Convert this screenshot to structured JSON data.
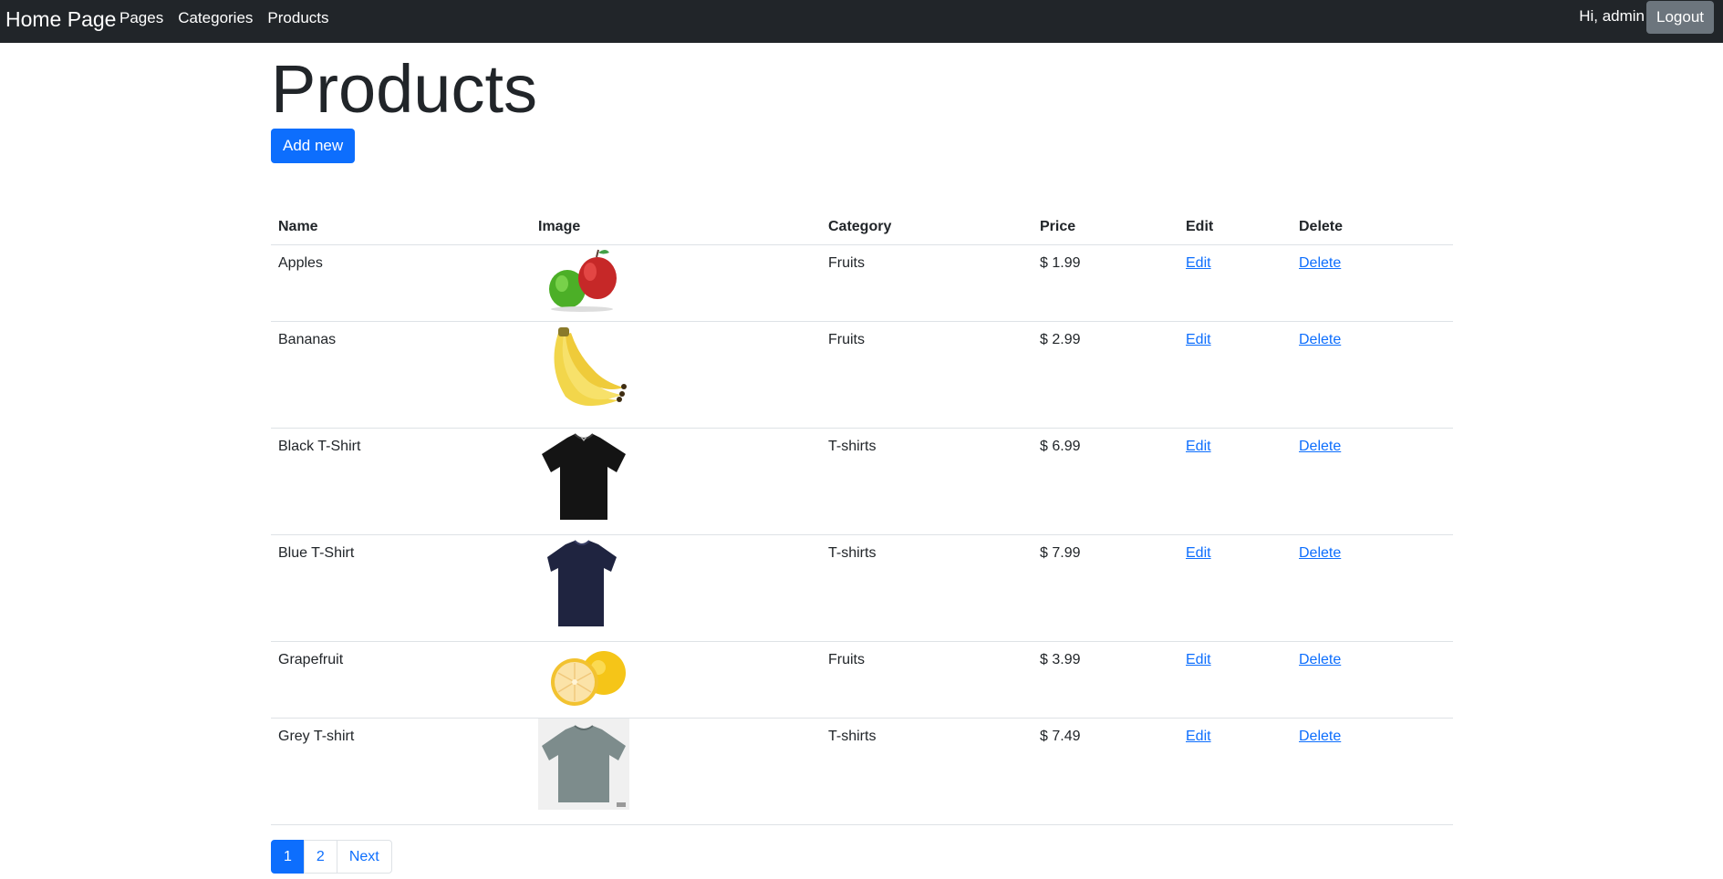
{
  "navbar": {
    "brand": "Home Page",
    "links": [
      "Pages",
      "Categories",
      "Products"
    ],
    "greeting": "Hi, admin",
    "logout_label": "Logout"
  },
  "page": {
    "title": "Products",
    "add_label": "Add new"
  },
  "table": {
    "headers": [
      "Name",
      "Image",
      "Category",
      "Price",
      "Edit",
      "Delete"
    ],
    "rows": [
      {
        "name": "Apples",
        "image": "apples",
        "category": "Fruits",
        "price": "$ 1.99",
        "edit": "Edit",
        "delete": "Delete"
      },
      {
        "name": "Bananas",
        "image": "bananas",
        "category": "Fruits",
        "price": "$ 2.99",
        "edit": "Edit",
        "delete": "Delete"
      },
      {
        "name": "Black T-Shirt",
        "image": "black-tshirt",
        "category": "T-shirts",
        "price": "$ 6.99",
        "edit": "Edit",
        "delete": "Delete"
      },
      {
        "name": "Blue T-Shirt",
        "image": "blue-tshirt",
        "category": "T-shirts",
        "price": "$ 7.99",
        "edit": "Edit",
        "delete": "Delete"
      },
      {
        "name": "Grapefruit",
        "image": "grapefruit",
        "category": "Fruits",
        "price": "$ 3.99",
        "edit": "Edit",
        "delete": "Delete"
      },
      {
        "name": "Grey T-shirt",
        "image": "grey-tshirt",
        "category": "T-shirts",
        "price": "$ 7.49",
        "edit": "Edit",
        "delete": "Delete"
      }
    ]
  },
  "pagination": {
    "pages": [
      "1",
      "2"
    ],
    "next_label": "Next",
    "current": "1"
  },
  "colors": {
    "navbar_bg": "#212529",
    "primary": "#0d6efd",
    "secondary": "#6c757d"
  }
}
